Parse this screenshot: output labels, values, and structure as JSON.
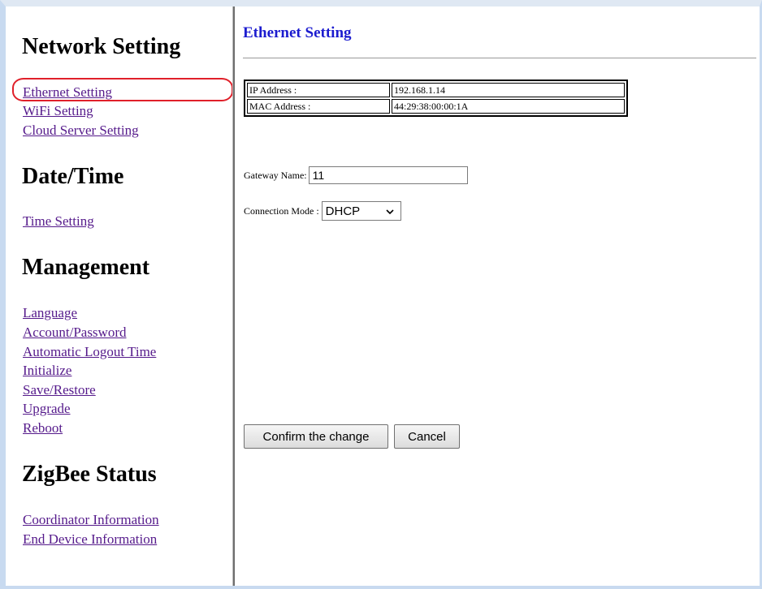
{
  "sidebar": {
    "sections": [
      {
        "title": "Network Setting",
        "links": [
          "Ethernet Setting",
          "WiFi Setting",
          "Cloud Server Setting"
        ]
      },
      {
        "title": "Date/Time",
        "links": [
          "Time Setting"
        ]
      },
      {
        "title": "Management",
        "links": [
          "Language",
          "Account/Password",
          "Automatic Logout Time",
          "Initialize",
          "Save/Restore",
          "Upgrade",
          "Reboot"
        ]
      },
      {
        "title": "ZigBee Status",
        "links": [
          "Coordinator Information",
          "End Device Information"
        ]
      }
    ],
    "highlighted_link": "Ethernet Setting",
    "highlight_color": "#e0202a",
    "visited_link_color": "#551a8b"
  },
  "main": {
    "title": "Ethernet Setting",
    "title_color": "#1c1ccf",
    "info": {
      "ip_label": "IP Address :",
      "ip_value": "192.168.1.14",
      "mac_label": "MAC Address :",
      "mac_value": "44:29:38:00:00:1A"
    },
    "gateway": {
      "label": "Gateway Name:",
      "value": "11"
    },
    "connection": {
      "label": "Connection Mode :",
      "selected": "DHCP"
    },
    "buttons": {
      "confirm": "Confirm the change",
      "cancel": "Cancel"
    }
  }
}
